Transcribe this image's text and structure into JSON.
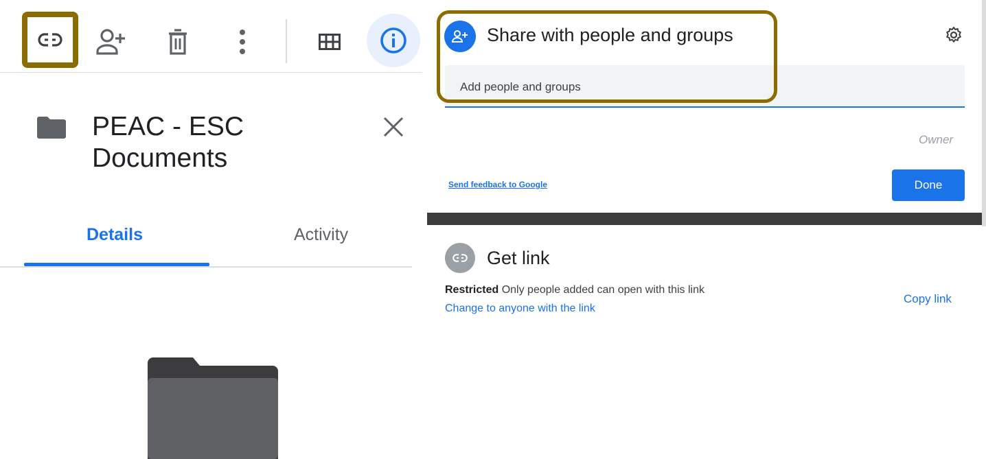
{
  "left_panel": {
    "folder_title": "PEAC - ESC Documents",
    "tabs": [
      {
        "label": "Details",
        "active": true
      },
      {
        "label": "Activity",
        "active": false
      }
    ],
    "toolbar_icons": [
      "link-icon",
      "add-person-icon",
      "trash-icon",
      "more-vert-icon",
      "grid-view-icon",
      "info-icon"
    ]
  },
  "share_dialog": {
    "title": "Share with people and groups",
    "input_placeholder": "Add people and groups",
    "owner_label": "Owner",
    "feedback_link": "Send feedback to Google",
    "done_label": "Done"
  },
  "get_link": {
    "title": "Get link",
    "restricted_label": "Restricted",
    "restricted_text": "Only people added can open with this link",
    "change_link": "Change to anyone with the link",
    "copy_link": "Copy link"
  },
  "colors": {
    "accent": "#1a73e8",
    "highlight": "#8a6c00",
    "icon_gray": "#5f6368",
    "folder_gray": "#5f6368"
  }
}
